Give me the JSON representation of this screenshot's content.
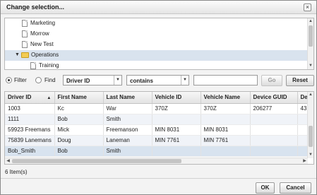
{
  "dialog": {
    "title": "Change selection...",
    "close_label": "×"
  },
  "tree": {
    "items": [
      {
        "label": "Marketing",
        "type": "document"
      },
      {
        "label": "Morrow",
        "type": "document"
      },
      {
        "label": "New Test",
        "type": "document"
      },
      {
        "label": "Operations",
        "type": "folder",
        "expanded": true,
        "selected": true
      },
      {
        "label": "Training",
        "type": "document"
      }
    ],
    "expander_glyph": "▼"
  },
  "filter": {
    "filter_label": "Filter",
    "find_label": "Find",
    "mode_selected": "filter",
    "field_value": "Driver ID",
    "operator_value": "contains",
    "text_value": "",
    "go_label": "Go",
    "reset_label": "Reset"
  },
  "grid": {
    "columns": [
      "Driver ID",
      "First Name",
      "Last Name",
      "Vehicle ID",
      "Vehicle Name",
      "Device GUID",
      "De"
    ],
    "sort_indicator": "▲",
    "rows": [
      [
        "1003",
        "Kc",
        "War",
        "370Z",
        "370Z",
        "206277",
        "43"
      ],
      [
        "1111",
        "Bob",
        "Smith",
        "",
        "",
        "",
        ""
      ],
      [
        "59923 Freemans",
        "Mick",
        "Freemanson",
        "MIN 8031",
        "MIN 8031",
        "",
        ""
      ],
      [
        "75839 Lanemans",
        "Doug",
        "Laneman",
        "MIN 7761",
        "MIN 7761",
        "",
        ""
      ],
      [
        "Bob_Smith",
        "Bob",
        "Smith",
        "",
        "",
        "",
        ""
      ]
    ]
  },
  "footer": {
    "count_text": "6 Item(s)",
    "ok_label": "OK",
    "cancel_label": "Cancel"
  },
  "colors": {
    "selection": "#d9e3ee",
    "folder": "#f3cc55"
  }
}
